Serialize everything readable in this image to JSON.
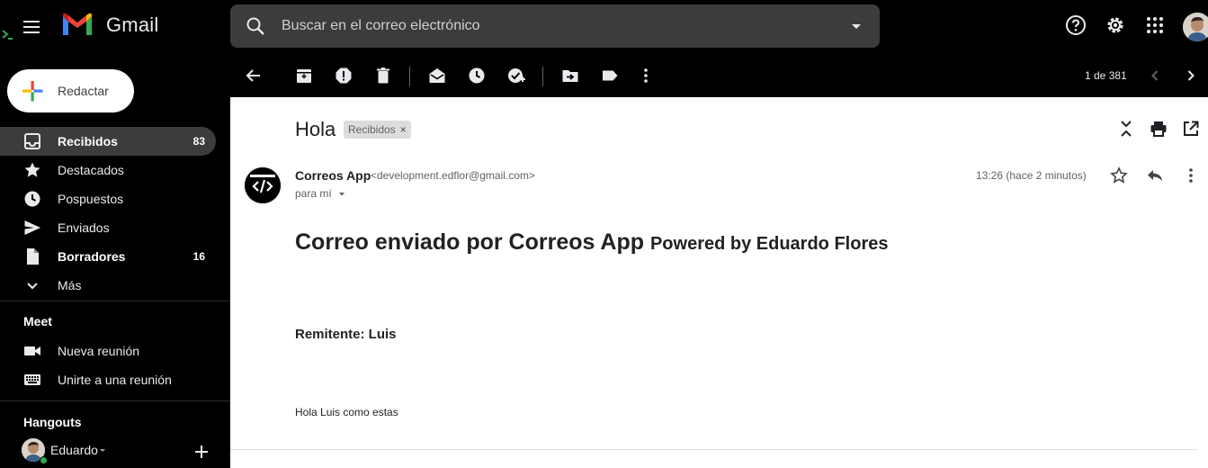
{
  "app": {
    "name": "Gmail",
    "search_placeholder": "Buscar en el correo electrónico"
  },
  "compose": {
    "label": "Redactar"
  },
  "sidebar": {
    "items": [
      {
        "label": "Recibidos",
        "count": "83",
        "icon": "inbox-icon",
        "active": true,
        "bold": true
      },
      {
        "label": "Destacados",
        "count": "",
        "icon": "star-icon"
      },
      {
        "label": "Pospuestos",
        "count": "",
        "icon": "clock-icon"
      },
      {
        "label": "Enviados",
        "count": "",
        "icon": "send-icon"
      },
      {
        "label": "Borradores",
        "count": "16",
        "icon": "draft-icon",
        "bold": true
      },
      {
        "label": "Más",
        "count": "",
        "icon": "chevron-down-icon"
      }
    ],
    "meet": {
      "title": "Meet",
      "items": [
        {
          "label": "Nueva reunión",
          "icon": "video-icon"
        },
        {
          "label": "Unirte a una reunión",
          "icon": "keyboard-icon"
        }
      ]
    },
    "hangouts": {
      "title": "Hangouts",
      "user": "Eduardo"
    }
  },
  "toolbar": {
    "pager": "1 de 381"
  },
  "message": {
    "subject": "Hola",
    "label": "Recibidos",
    "sender_name": "Correos App",
    "sender_email": "<development.edflor@gmail.com>",
    "to": "para mí",
    "time": "13:26 (hace 2 minutos)",
    "body": {
      "heading": "Correo enviado por Correos App",
      "heading_small": "Powered by Eduardo Flores",
      "remitente": "Remitente: Luis",
      "text": "Hola Luis como estas"
    }
  },
  "colors": {
    "background": "#000000",
    "active_item": "#3c3c3c",
    "search_bg": "#3c3c3c",
    "pane_bg": "#ffffff"
  }
}
